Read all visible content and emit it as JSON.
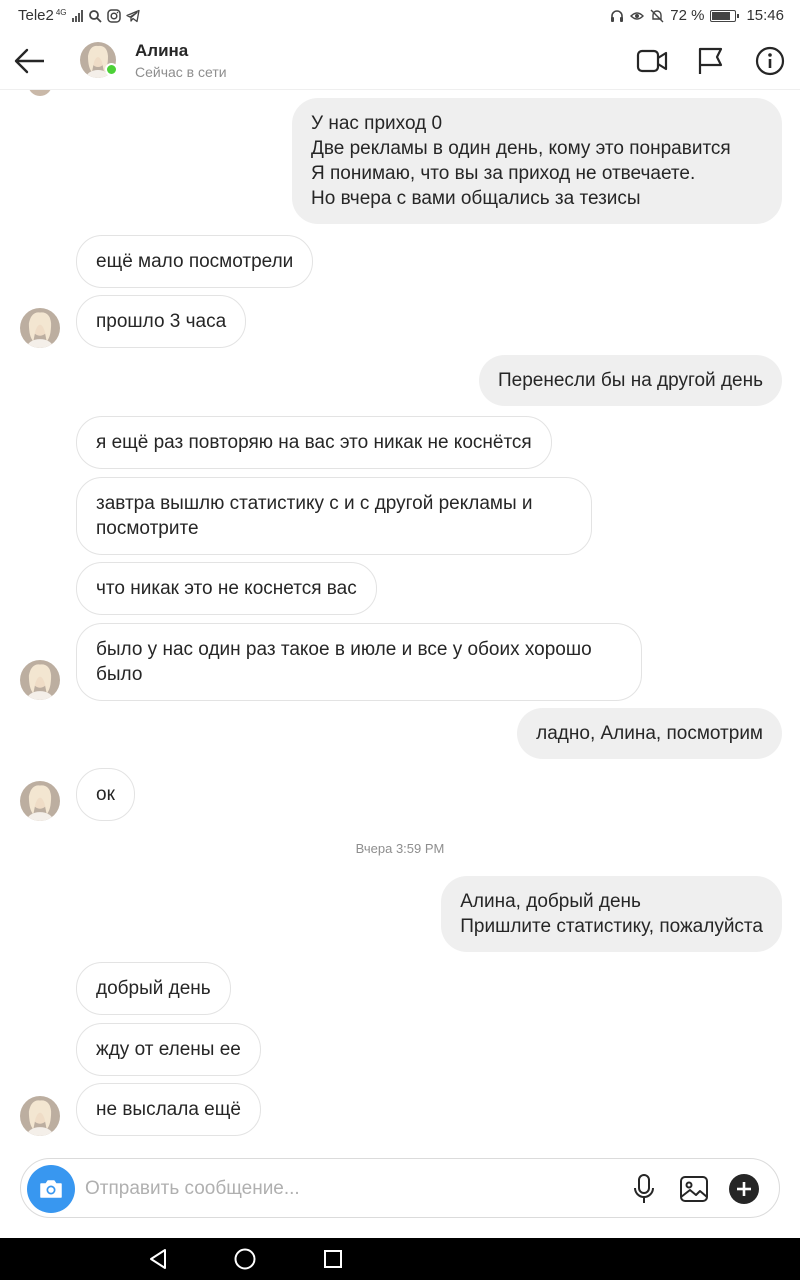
{
  "status_bar": {
    "carrier": "Tele2",
    "network": "4G",
    "battery_percent": "72 %",
    "battery_level": 0.72,
    "time": "15:46"
  },
  "header": {
    "name": "Алина",
    "status": "Сейчас в сети"
  },
  "messages": [
    {
      "side": "me",
      "text": "У нас приход 0\nДве рекламы в один день, кому это понравится\nЯ понимаю, что вы за приход не отвечаете.\nНо вчера с вами общались за тезисы"
    },
    {
      "side": "them",
      "text": "ещё мало посмотрели"
    },
    {
      "side": "them",
      "text": "прошло 3 часа"
    },
    {
      "side": "me",
      "text": "Перенесли бы на другой день"
    },
    {
      "side": "them",
      "text": "я ещё раз повторяю на вас это никак не коснётся"
    },
    {
      "side": "them",
      "text": "завтра вышлю статистику с и с другой рекламы и\nпосмотрите"
    },
    {
      "side": "them",
      "text": "что никак это не коснется вас"
    },
    {
      "side": "them",
      "text": "было у нас один раз такое в июле и все у обоих хорошо\nбыло"
    },
    {
      "side": "me",
      "text": "ладно, Алина, посмотрим"
    },
    {
      "side": "them",
      "text": "ок"
    },
    {
      "side": "me",
      "text": "Алина, добрый день\nПришлите статистику, пожалуйста"
    },
    {
      "side": "them",
      "text": "добрый день"
    },
    {
      "side": "them",
      "text": "жду от елены ее"
    },
    {
      "side": "them",
      "text": "не выслала ещё"
    }
  ],
  "timestamp": "Вчера 3:59 PM",
  "composer": {
    "placeholder": "Отправить сообщение..."
  },
  "colors": {
    "accent": "#3897f0",
    "online": "#4cd137",
    "outgoing_bubble": "#efefef"
  },
  "icons": [
    "back-arrow-icon",
    "video-call-icon",
    "flag-icon",
    "info-icon",
    "camera-icon",
    "microphone-icon",
    "gallery-icon",
    "plus-icon",
    "nav-back-icon",
    "nav-home-icon",
    "nav-recents-icon"
  ]
}
